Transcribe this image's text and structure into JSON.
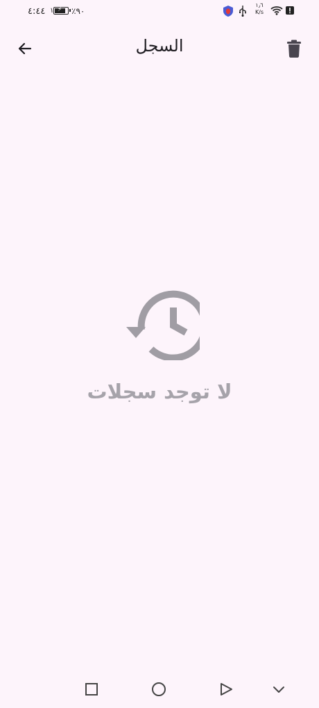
{
  "status_bar": {
    "time": "٤:٤٤",
    "sim_indicator": "١",
    "battery_percent": "٪٩٠",
    "battery_level": 0.9,
    "net_speed_value": "١٫٦",
    "net_speed_unit": "K/s",
    "icons": [
      "shield-icon",
      "usb-icon",
      "wifi-icon",
      "alert-icon",
      "battery-icon"
    ]
  },
  "app_bar": {
    "title": "السجل",
    "back_icon": "arrow-back-icon",
    "delete_icon": "trash-icon"
  },
  "empty_state": {
    "icon": "history-icon",
    "message": "لا توجد سجلات"
  },
  "nav_bar": {
    "buttons": [
      "recents-square-icon",
      "home-circle-icon",
      "back-triangle-icon",
      "collapse-chevron-icon"
    ]
  },
  "colors": {
    "background": "#fdf4fb",
    "title_text": "#1d1b20",
    "empty_icon": "#a09da4",
    "empty_text": "#a6a3aa"
  }
}
